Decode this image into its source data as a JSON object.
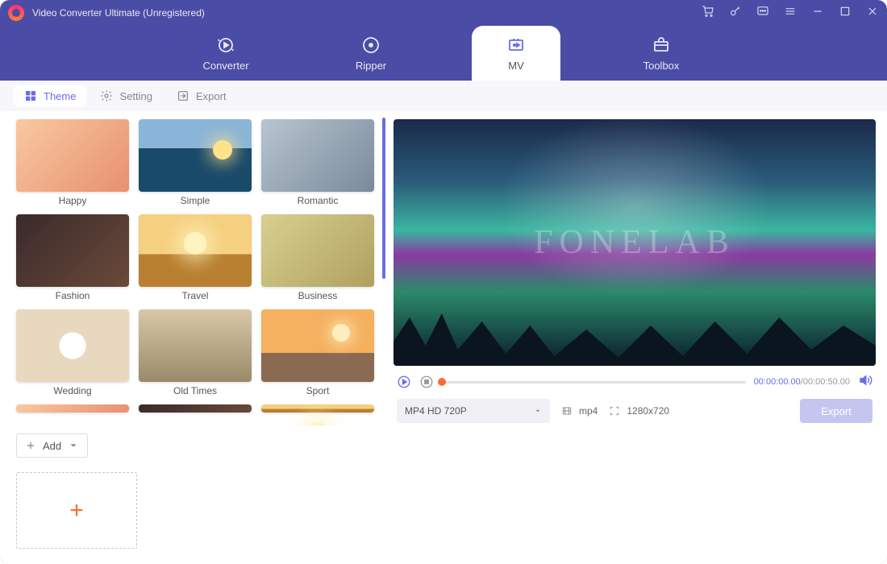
{
  "app": {
    "title": "Video Converter Ultimate (Unregistered)"
  },
  "tabs": {
    "converter": "Converter",
    "ripper": "Ripper",
    "mv": "MV",
    "toolbox": "Toolbox"
  },
  "subtabs": {
    "theme": "Theme",
    "setting": "Setting",
    "export": "Export"
  },
  "themes": [
    {
      "label": "Happy"
    },
    {
      "label": "Simple"
    },
    {
      "label": "Romantic"
    },
    {
      "label": "Fashion"
    },
    {
      "label": "Travel"
    },
    {
      "label": "Business"
    },
    {
      "label": "Wedding"
    },
    {
      "label": "Old Times"
    },
    {
      "label": "Sport"
    }
  ],
  "preview": {
    "watermark": "FONELAB",
    "time_current": "00:00:00.00",
    "time_total": "00:00:50.00",
    "format_dropdown": "MP4 HD 720P",
    "format_ext": "mp4",
    "resolution": "1280x720",
    "export_button": "Export"
  },
  "bottom": {
    "add_button": "Add"
  }
}
